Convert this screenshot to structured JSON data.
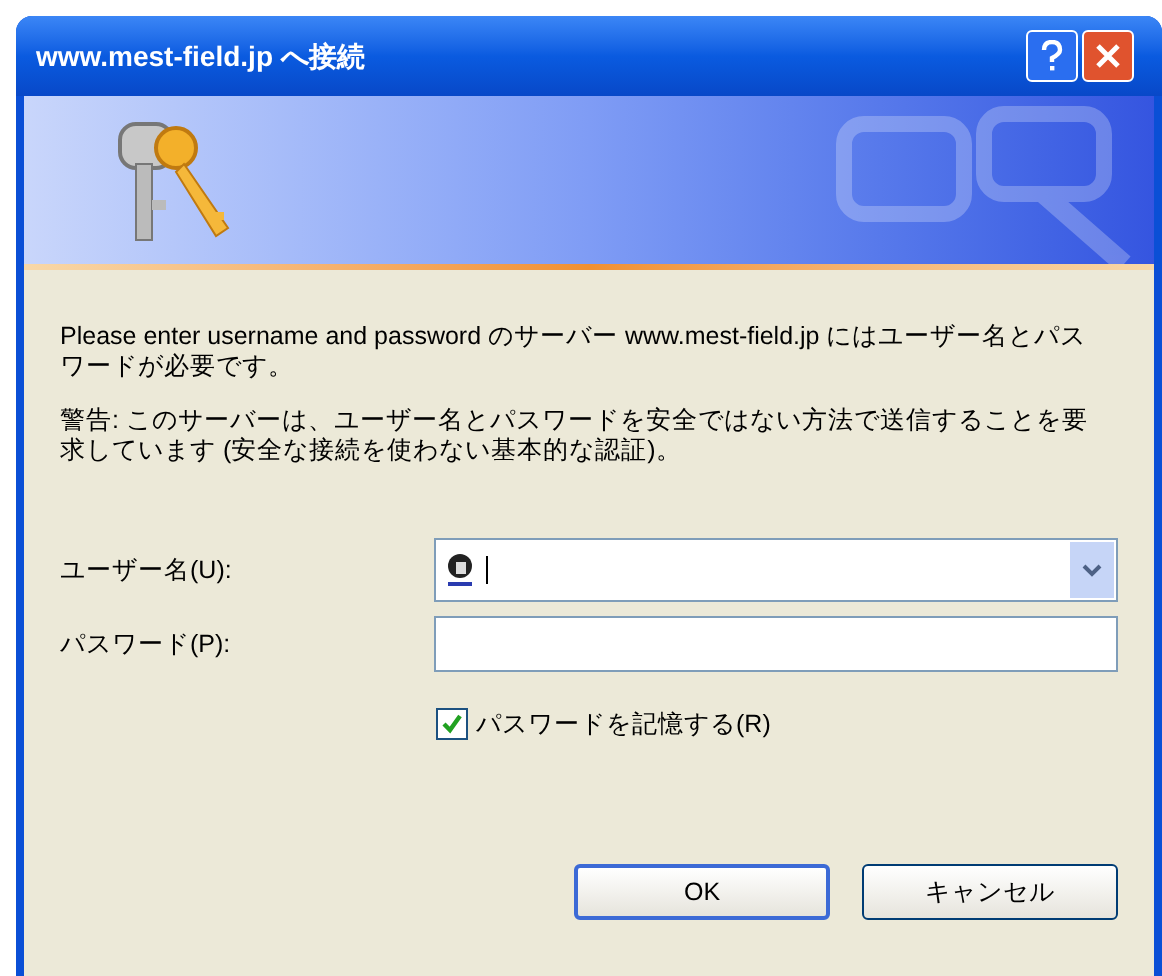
{
  "window": {
    "title": "www.mest-field.jp へ接続"
  },
  "message": "Please enter username and password のサーバー www.mest-field.jp にはユーザー名とパスワードが必要です。",
  "warning": "警告: このサーバーは、ユーザー名とパスワードを安全ではない方法で送信することを要求しています (安全な接続を使わない基本的な認証)。",
  "username": {
    "label": "ユーザー名(U):"
  },
  "password": {
    "label": "パスワード(P):"
  },
  "remember": {
    "label": "パスワードを記憶する(R)",
    "checked": true
  },
  "buttons": [
    {
      "label": "OK",
      "default": true
    },
    {
      "label": "キャンセル",
      "default": false
    }
  ]
}
